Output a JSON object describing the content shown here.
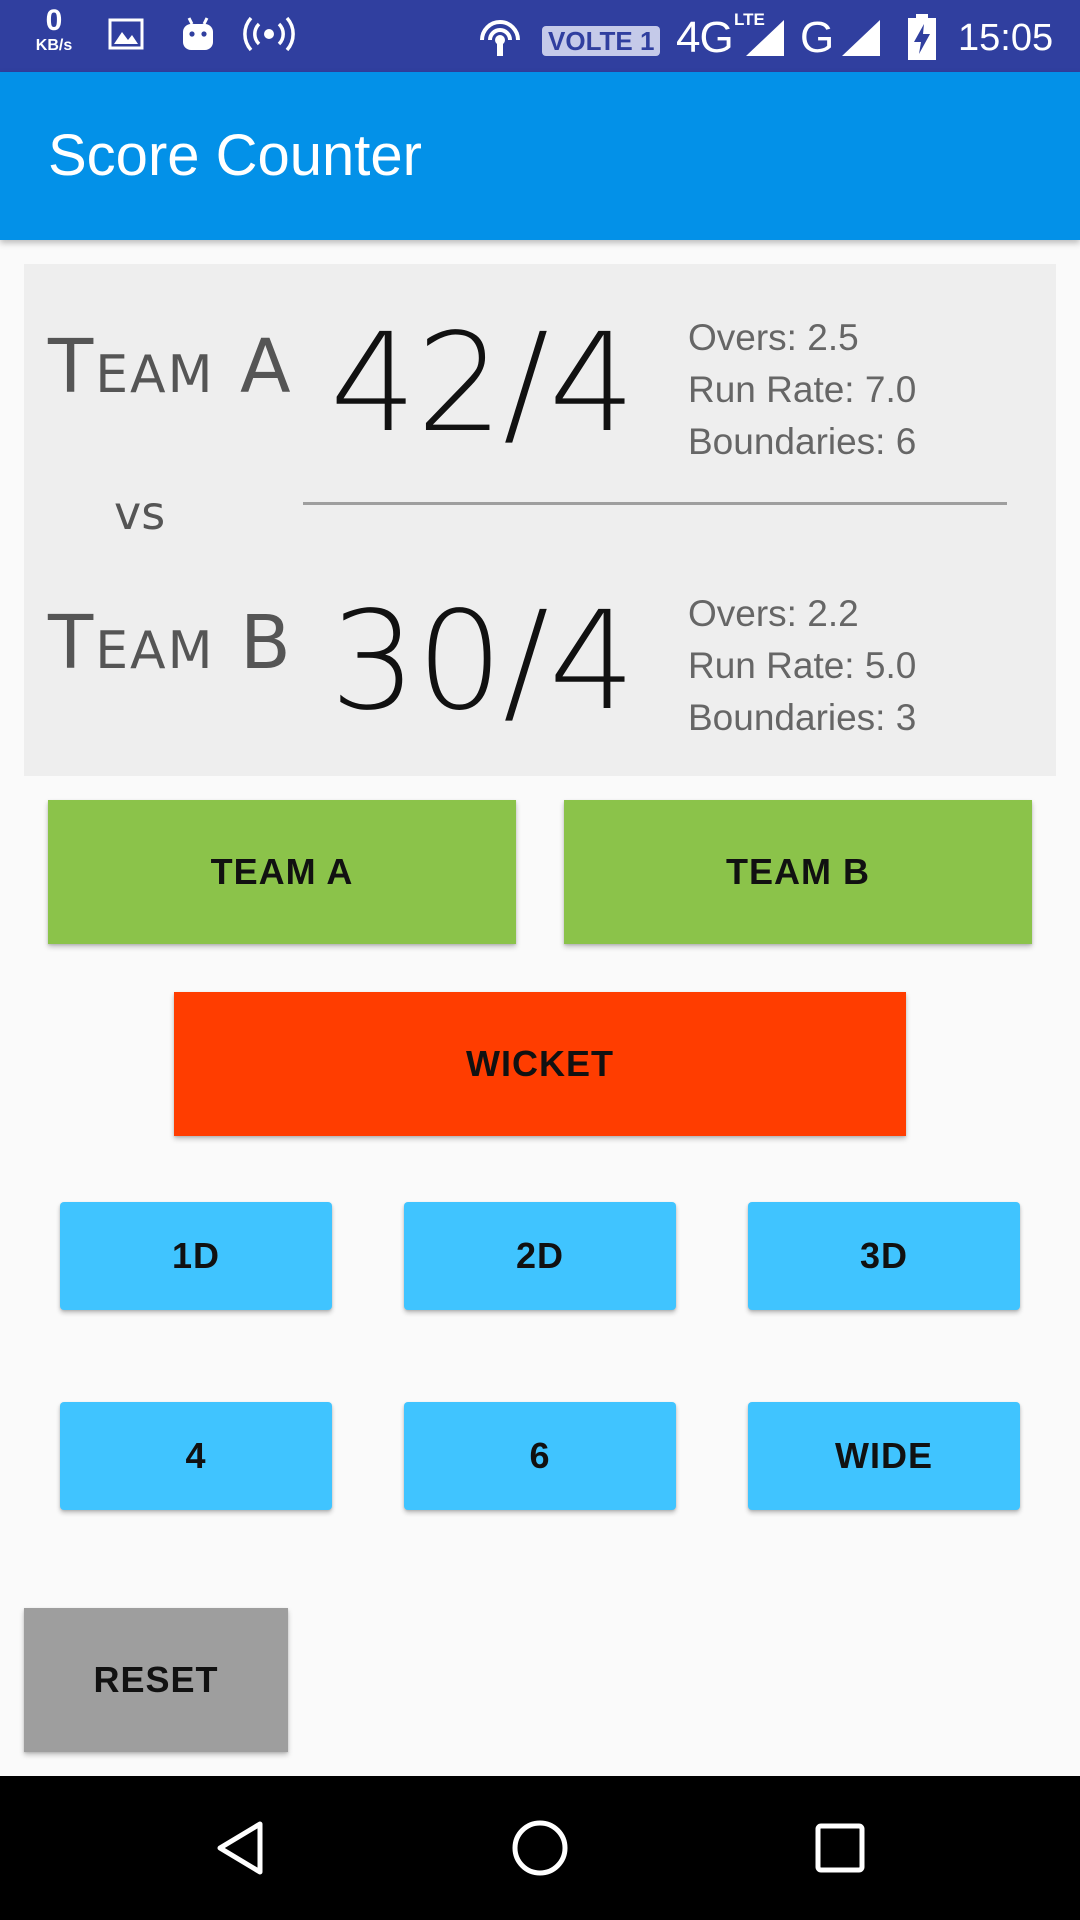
{
  "status_bar": {
    "data_rate": "0",
    "data_rate_unit": "KB/s",
    "volte_badge": "VOLTE 1",
    "network_primary": "4G",
    "network_lte": "LTE",
    "network_secondary": "G",
    "time": "15:05",
    "icons": [
      "gallery-icon",
      "android-icon",
      "hotspot-icon",
      "wifi-calling-icon",
      "signal-icon",
      "battery-charging-icon"
    ]
  },
  "app_bar": {
    "title": "Score Counter",
    "color": "#0391e8"
  },
  "scoreboard": {
    "vs_label": "vs",
    "team_a": {
      "name": "Team A",
      "score": "42/4",
      "overs": "Overs: 2.5",
      "run_rate": "Run Rate: 7.0",
      "boundaries": "Boundaries: 6"
    },
    "team_b": {
      "name": "Team B",
      "score": "30/4",
      "overs": "Overs: 2.2",
      "run_rate": "Run Rate: 5.0",
      "boundaries": "Boundaries: 3"
    }
  },
  "buttons": {
    "team_a": "TEAM A",
    "team_b": "TEAM B",
    "wicket": "WICKET",
    "run_1d": "1D",
    "run_2d": "2D",
    "run_3d": "3D",
    "run_4": "4",
    "run_6": "6",
    "wide": "WIDE",
    "reset": "RESET"
  },
  "colors": {
    "status_bar": "#303f9f",
    "team_button": "#8bc34a",
    "wicket_button": "#ff3d00",
    "run_button": "#40c4ff",
    "reset_button": "#9e9e9e"
  },
  "nav_bar": {
    "icons": [
      "back-icon",
      "home-icon",
      "recents-icon"
    ]
  }
}
